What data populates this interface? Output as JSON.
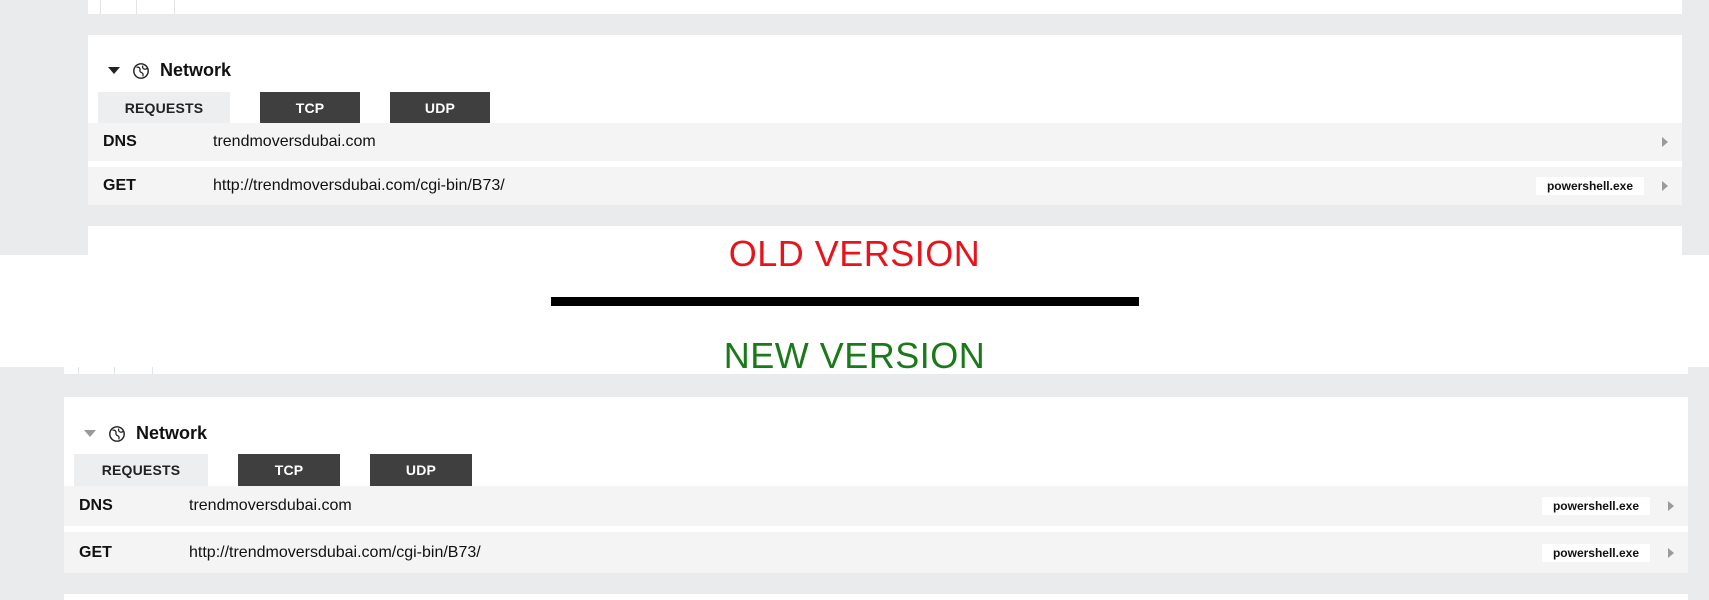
{
  "comparison": {
    "old_label": "OLD VERSION",
    "new_label": "NEW VERSION"
  },
  "old_panel": {
    "title": "Network",
    "icon": "globe-icon",
    "tabs": [
      {
        "label": "REQUESTS",
        "active": true
      },
      {
        "label": "TCP",
        "active": false
      },
      {
        "label": "UDP",
        "active": false
      }
    ],
    "rows": [
      {
        "method": "DNS",
        "value": "trendmoversdubai.com",
        "process": ""
      },
      {
        "method": "GET",
        "value": "http://trendmoversdubai.com/cgi-bin/B73/",
        "process": "powershell.exe"
      }
    ]
  },
  "new_panel": {
    "title": "Network",
    "icon": "globe-icon",
    "tabs": [
      {
        "label": "REQUESTS",
        "active": true
      },
      {
        "label": "TCP",
        "active": false
      },
      {
        "label": "UDP",
        "active": false
      }
    ],
    "rows": [
      {
        "method": "DNS",
        "value": "trendmoversdubai.com",
        "process": "powershell.exe"
      },
      {
        "method": "GET",
        "value": "http://trendmoversdubai.com/cgi-bin/B73/",
        "process": "powershell.exe"
      }
    ]
  },
  "colors": {
    "old_label": "#e8141b",
    "new_label": "#1a7a19",
    "dark_tab": "#3f3f3f",
    "page_bg": "#e9ebed"
  }
}
